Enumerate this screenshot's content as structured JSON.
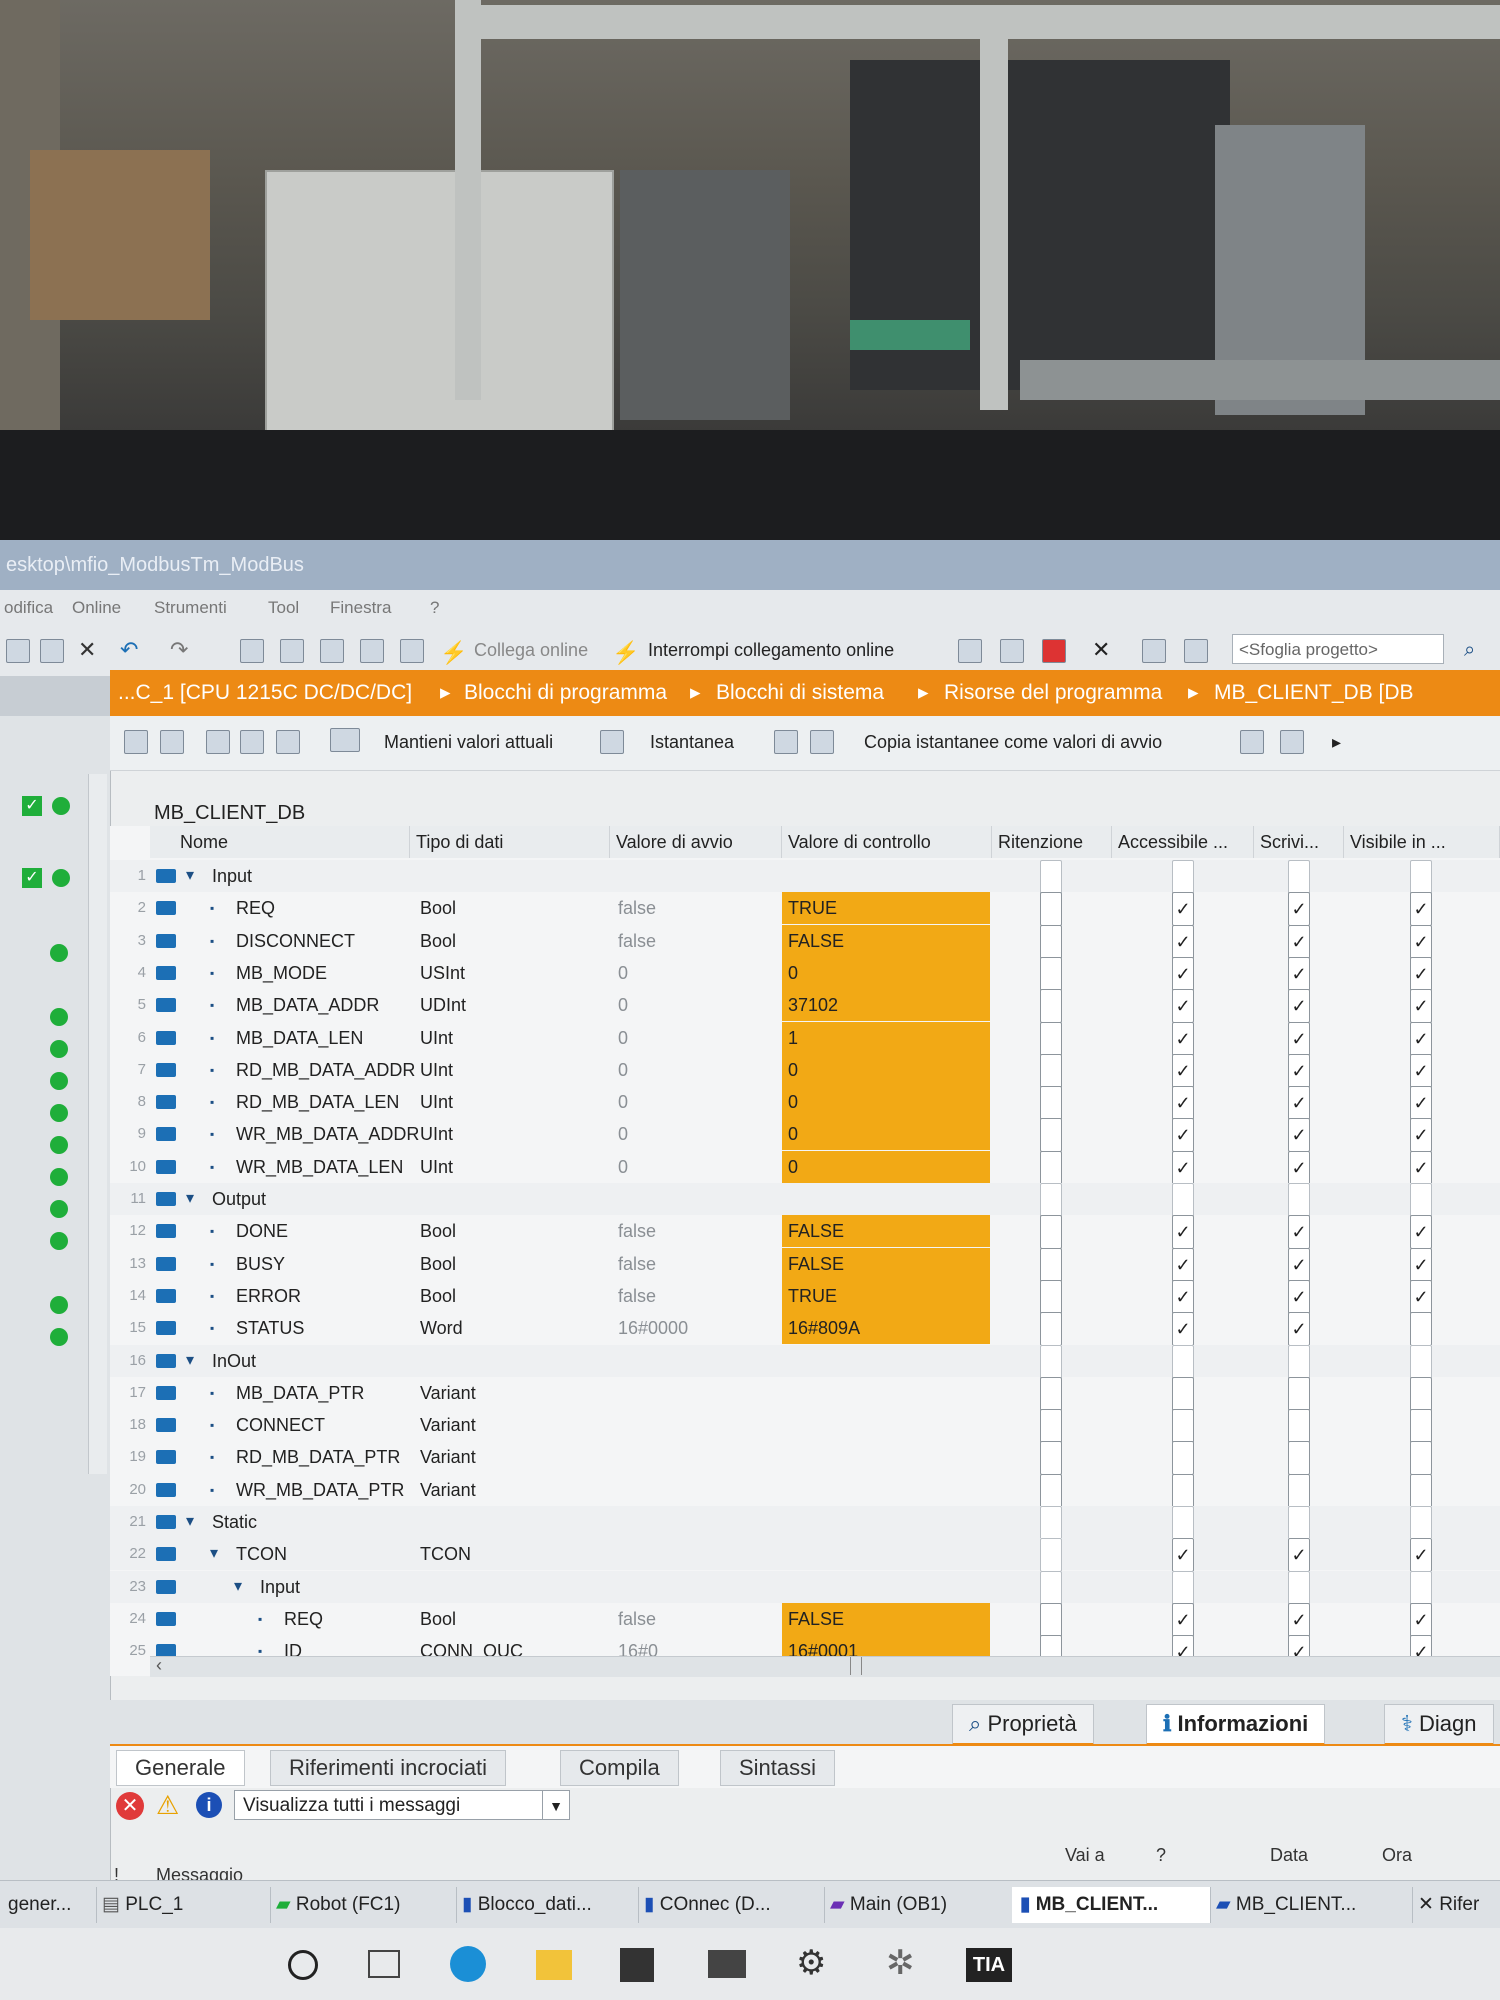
{
  "window": {
    "title": "esktop\\mfio_ModbusTm_ModBus"
  },
  "menu": [
    "odifica",
    "Online",
    "Strumenti",
    "Tool",
    "Finestra",
    "?"
  ],
  "toolbar": {
    "go_online": "Collega online",
    "go_offline": "Interrompi collegamento online",
    "search_placeholder": "<Sfoglia progetto>"
  },
  "breadcrumb": [
    "...C_1 [CPU 1215C DC/DC/DC]",
    "Blocchi di programma",
    "Blocchi di sistema",
    "Risorse del programma",
    "MB_CLIENT_DB [DB"
  ],
  "editor_toolbar": {
    "keep_values": "Mantieni valori attuali",
    "snapshot": "Istantanea",
    "copy_snapshots": "Copia istantanee come valori di avvio"
  },
  "db_name": "MB_CLIENT_DB",
  "columns": [
    "Nome",
    "Tipo di dati",
    "Valore di avvio",
    "Valore di controllo",
    "Ritenzione",
    "Accessibile ...",
    "Scrivi...",
    "Visibile in ..."
  ],
  "rows": [
    {
      "n": "1",
      "name": "Input",
      "level": 0,
      "section": true,
      "type": "",
      "start": "",
      "monitor": "",
      "ret": false,
      "acc": false,
      "wri": false,
      "vis": false
    },
    {
      "n": "2",
      "name": "REQ",
      "level": 1,
      "type": "Bool",
      "start": "false",
      "monitor": "TRUE",
      "ret": false,
      "acc": true,
      "wri": true,
      "vis": true
    },
    {
      "n": "3",
      "name": "DISCONNECT",
      "level": 1,
      "type": "Bool",
      "start": "false",
      "monitor": "FALSE",
      "ret": false,
      "acc": true,
      "wri": true,
      "vis": true
    },
    {
      "n": "4",
      "name": "MB_MODE",
      "level": 1,
      "type": "USInt",
      "start": "0",
      "monitor": "0",
      "ret": false,
      "acc": true,
      "wri": true,
      "vis": true
    },
    {
      "n": "5",
      "name": "MB_DATA_ADDR",
      "level": 1,
      "type": "UDInt",
      "start": "0",
      "monitor": "37102",
      "ret": false,
      "acc": true,
      "wri": true,
      "vis": true
    },
    {
      "n": "6",
      "name": "MB_DATA_LEN",
      "level": 1,
      "type": "UInt",
      "start": "0",
      "monitor": "1",
      "ret": false,
      "acc": true,
      "wri": true,
      "vis": true
    },
    {
      "n": "7",
      "name": "RD_MB_DATA_ADDR",
      "level": 1,
      "type": "UInt",
      "start": "0",
      "monitor": "0",
      "ret": false,
      "acc": true,
      "wri": true,
      "vis": true
    },
    {
      "n": "8",
      "name": "RD_MB_DATA_LEN",
      "level": 1,
      "type": "UInt",
      "start": "0",
      "monitor": "0",
      "ret": false,
      "acc": true,
      "wri": true,
      "vis": true
    },
    {
      "n": "9",
      "name": "WR_MB_DATA_ADDR",
      "level": 1,
      "type": "UInt",
      "start": "0",
      "monitor": "0",
      "ret": false,
      "acc": true,
      "wri": true,
      "vis": true
    },
    {
      "n": "10",
      "name": "WR_MB_DATA_LEN",
      "level": 1,
      "type": "UInt",
      "start": "0",
      "monitor": "0",
      "ret": false,
      "acc": true,
      "wri": true,
      "vis": true
    },
    {
      "n": "11",
      "name": "Output",
      "level": 0,
      "section": true,
      "type": "",
      "start": "",
      "monitor": "",
      "ret": false,
      "acc": false,
      "wri": false,
      "vis": false
    },
    {
      "n": "12",
      "name": "DONE",
      "level": 1,
      "type": "Bool",
      "start": "false",
      "monitor": "FALSE",
      "ret": false,
      "acc": true,
      "wri": true,
      "vis": true
    },
    {
      "n": "13",
      "name": "BUSY",
      "level": 1,
      "type": "Bool",
      "start": "false",
      "monitor": "FALSE",
      "ret": false,
      "acc": true,
      "wri": true,
      "vis": true
    },
    {
      "n": "14",
      "name": "ERROR",
      "level": 1,
      "type": "Bool",
      "start": "false",
      "monitor": "TRUE",
      "ret": false,
      "acc": true,
      "wri": true,
      "vis": true
    },
    {
      "n": "15",
      "name": "STATUS",
      "level": 1,
      "type": "Word",
      "start": "16#0000",
      "monitor": "16#809A",
      "ret": false,
      "acc": true,
      "wri": true,
      "vis": false
    },
    {
      "n": "16",
      "name": "InOut",
      "level": 0,
      "section": true,
      "type": "",
      "start": "",
      "monitor": "",
      "ret": false,
      "acc": false,
      "wri": false,
      "vis": false
    },
    {
      "n": "17",
      "name": "MB_DATA_PTR",
      "level": 1,
      "type": "Variant",
      "start": "",
      "monitor": "",
      "ret": false,
      "acc": false,
      "wri": false,
      "vis": false
    },
    {
      "n": "18",
      "name": "CONNECT",
      "level": 1,
      "type": "Variant",
      "start": "",
      "monitor": "",
      "ret": false,
      "acc": false,
      "wri": false,
      "vis": false
    },
    {
      "n": "19",
      "name": "RD_MB_DATA_PTR",
      "level": 1,
      "type": "Variant",
      "start": "",
      "monitor": "",
      "ret": false,
      "acc": false,
      "wri": false,
      "vis": false
    },
    {
      "n": "20",
      "name": "WR_MB_DATA_PTR",
      "level": 1,
      "type": "Variant",
      "start": "",
      "monitor": "",
      "ret": false,
      "acc": false,
      "wri": false,
      "vis": false
    },
    {
      "n": "21",
      "name": "Static",
      "level": 0,
      "section": true,
      "type": "",
      "start": "",
      "monitor": "",
      "ret": false,
      "acc": false,
      "wri": false,
      "vis": false
    },
    {
      "n": "22",
      "name": "TCON",
      "level": 1,
      "section": true,
      "type": "TCON",
      "start": "",
      "monitor": "",
      "ret": false,
      "acc": true,
      "wri": true,
      "vis": true
    },
    {
      "n": "23",
      "name": "Input",
      "level": 2,
      "section": true,
      "type": "",
      "start": "",
      "monitor": "",
      "ret": false,
      "acc": false,
      "wri": false,
      "vis": false
    },
    {
      "n": "24",
      "name": "REQ",
      "level": 3,
      "type": "Bool",
      "start": "false",
      "monitor": "FALSE",
      "ret": false,
      "acc": true,
      "wri": true,
      "vis": true
    },
    {
      "n": "25",
      "name": "ID",
      "level": 3,
      "type": "CONN_OUC",
      "start": "16#0",
      "monitor": "16#0001",
      "ret": false,
      "acc": true,
      "wri": true,
      "vis": true
    }
  ],
  "inspector_tabs": [
    "Proprietà",
    "Informazioni",
    "Diagn"
  ],
  "info_tabs": [
    "Generale",
    "Riferimenti incrociati",
    "Compila",
    "Sintassi"
  ],
  "filter_value": "Visualizza tutti i messaggi",
  "message_columns": [
    "!",
    "Messaggio",
    "Vai a",
    "?",
    "Data",
    "Ora"
  ],
  "taskbar": [
    "gener...",
    "PLC_1",
    "Robot (FC1)",
    "Blocco_dati...",
    "COnnec (D...",
    "Main (OB1)",
    "MB_CLIENT...",
    "MB_CLIENT...",
    "Rifer"
  ],
  "colors": {
    "accent": "#ed8a14",
    "monitor_value_bg": "#f2a915",
    "status_green": "#1fae3a"
  }
}
